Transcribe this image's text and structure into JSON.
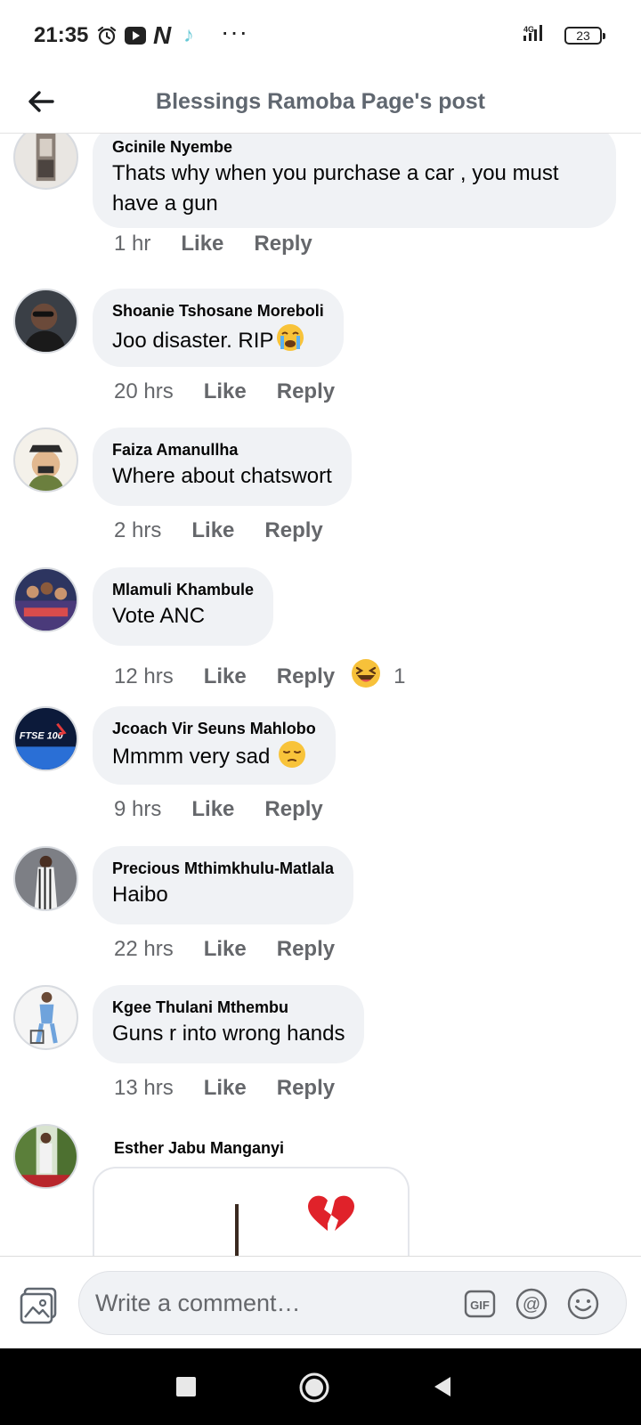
{
  "status_bar": {
    "time": "21:35",
    "network": "4G",
    "battery": "23",
    "more": "···"
  },
  "header": {
    "title": "Blessings Ramoba Page's post"
  },
  "comments": [
    {
      "name": "Gcinile Nyembe",
      "text": "Thats why when you purchase a car , you must have a gun",
      "time": "1 hr",
      "like": "Like",
      "reply": "Reply"
    },
    {
      "name": "Shoanie Tshosane Moreboli",
      "text": "Joo disaster. RIP",
      "emoji": "crying-face",
      "time": "20 hrs",
      "like": "Like",
      "reply": "Reply"
    },
    {
      "name": "Faiza Amanullha",
      "text": "Where about chatswort",
      "time": "2 hrs",
      "like": "Like",
      "reply": "Reply"
    },
    {
      "name": "Mlamuli Khambule",
      "text": "Vote ANC",
      "time": "12 hrs",
      "like": "Like",
      "reply": "Reply",
      "reaction": "laughing",
      "reaction_count": "1"
    },
    {
      "name": "Jcoach Vir Seuns Mahlobo",
      "text": "Mmmm very sad",
      "emoji": "pensive-face",
      "time": "9 hrs",
      "like": "Like",
      "reply": "Reply"
    },
    {
      "name": "Precious Mthimkhulu-Matlala",
      "text": "Haibo",
      "time": "22 hrs",
      "like": "Like",
      "reply": "Reply"
    },
    {
      "name": "Kgee Thulani Mthembu",
      "text": "Guns r into wrong hands",
      "time": "13 hrs",
      "like": "Like",
      "reply": "Reply"
    },
    {
      "name": "Esther Jabu Manganyi",
      "attachment": "broken-heart-sticker"
    }
  ],
  "avatar_text": {
    "ftse": "FTSE 100"
  },
  "composer": {
    "placeholder": "Write a comment…",
    "gif_label": "GIF",
    "at_label": "@"
  },
  "colors": {
    "bubble": "#f0f2f5",
    "meta_text": "#65676b",
    "header_title": "#606770",
    "navbar": "#000000"
  }
}
